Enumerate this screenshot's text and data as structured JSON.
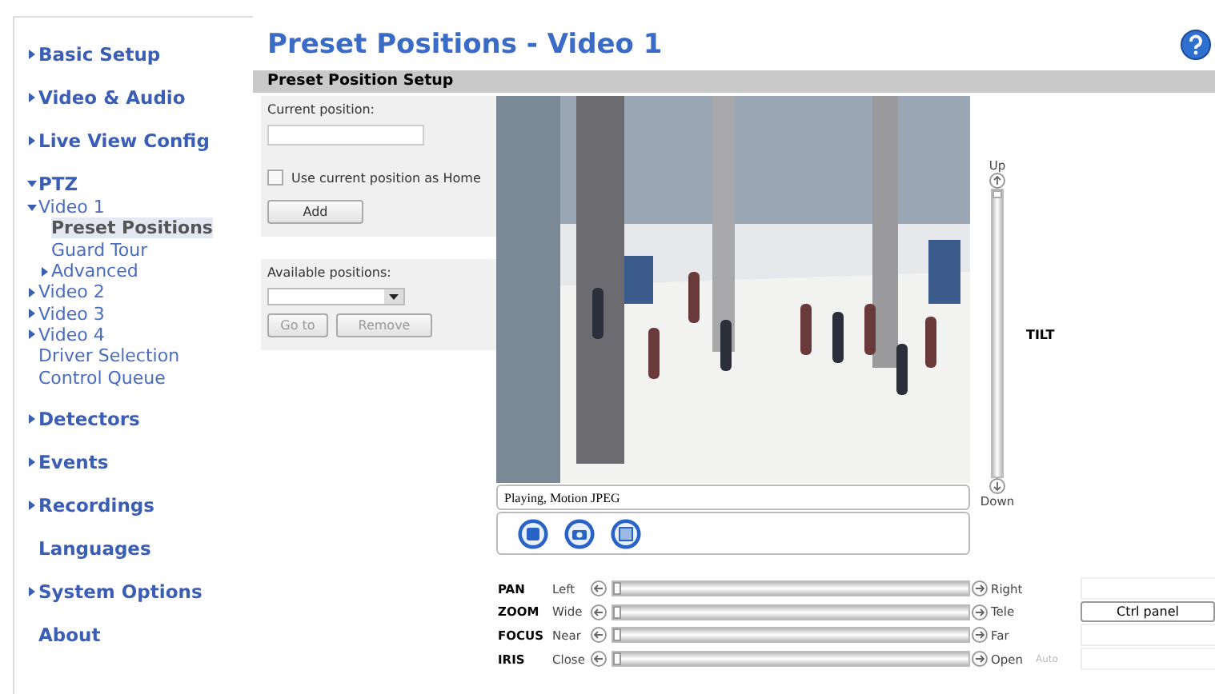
{
  "sidebar": {
    "items": [
      {
        "label": "Basic Setup",
        "kind": "group",
        "expanded": false
      },
      {
        "label": "Video & Audio",
        "kind": "group",
        "expanded": false
      },
      {
        "label": "Live View Config",
        "kind": "group",
        "expanded": false
      },
      {
        "label": "PTZ",
        "kind": "group",
        "expanded": true,
        "children": [
          {
            "label": "Video 1",
            "kind": "group",
            "expanded": true,
            "children": [
              {
                "label": "Preset Positions",
                "kind": "link",
                "selected": true
              },
              {
                "label": "Guard Tour",
                "kind": "link",
                "selected": false
              },
              {
                "label": "Advanced",
                "kind": "group",
                "expanded": false
              }
            ]
          },
          {
            "label": "Video 2",
            "kind": "group",
            "expanded": false
          },
          {
            "label": "Video 3",
            "kind": "group",
            "expanded": false
          },
          {
            "label": "Video 4",
            "kind": "group",
            "expanded": false
          },
          {
            "label": "Driver Selection",
            "kind": "link",
            "selected": false
          },
          {
            "label": "Control Queue",
            "kind": "link",
            "selected": false
          }
        ]
      },
      {
        "label": "Detectors",
        "kind": "group",
        "expanded": false
      },
      {
        "label": "Events",
        "kind": "group",
        "expanded": false
      },
      {
        "label": "Recordings",
        "kind": "group",
        "expanded": false
      },
      {
        "label": "Languages",
        "kind": "link",
        "selected": false
      },
      {
        "label": "System Options",
        "kind": "group",
        "expanded": false
      },
      {
        "label": "About",
        "kind": "link",
        "selected": false
      }
    ]
  },
  "page": {
    "title": "Preset Positions - Video 1",
    "section": "Preset Position Setup"
  },
  "setup": {
    "current_label": "Current position:",
    "home_label": "Use current position as Home",
    "home_checked": false,
    "add_button": "Add",
    "available_label": "Available positions:",
    "goto_button": "Go to",
    "remove_button": "Remove"
  },
  "video": {
    "status": "Playing, Motion JPEG"
  },
  "tilt": {
    "up": "Up",
    "down": "Down",
    "label": "TILT",
    "level": 1
  },
  "controls": [
    {
      "name": "PAN",
      "low": "Left",
      "high": "Right",
      "level": 0
    },
    {
      "name": "ZOOM",
      "low": "Wide",
      "high": "Tele",
      "level": 0,
      "button": "Ctrl panel"
    },
    {
      "name": "FOCUS",
      "low": "Near",
      "high": "Far",
      "level": 0
    },
    {
      "name": "IRIS",
      "low": "Close",
      "high": "Open",
      "level": 0,
      "extra": "Auto"
    }
  ]
}
